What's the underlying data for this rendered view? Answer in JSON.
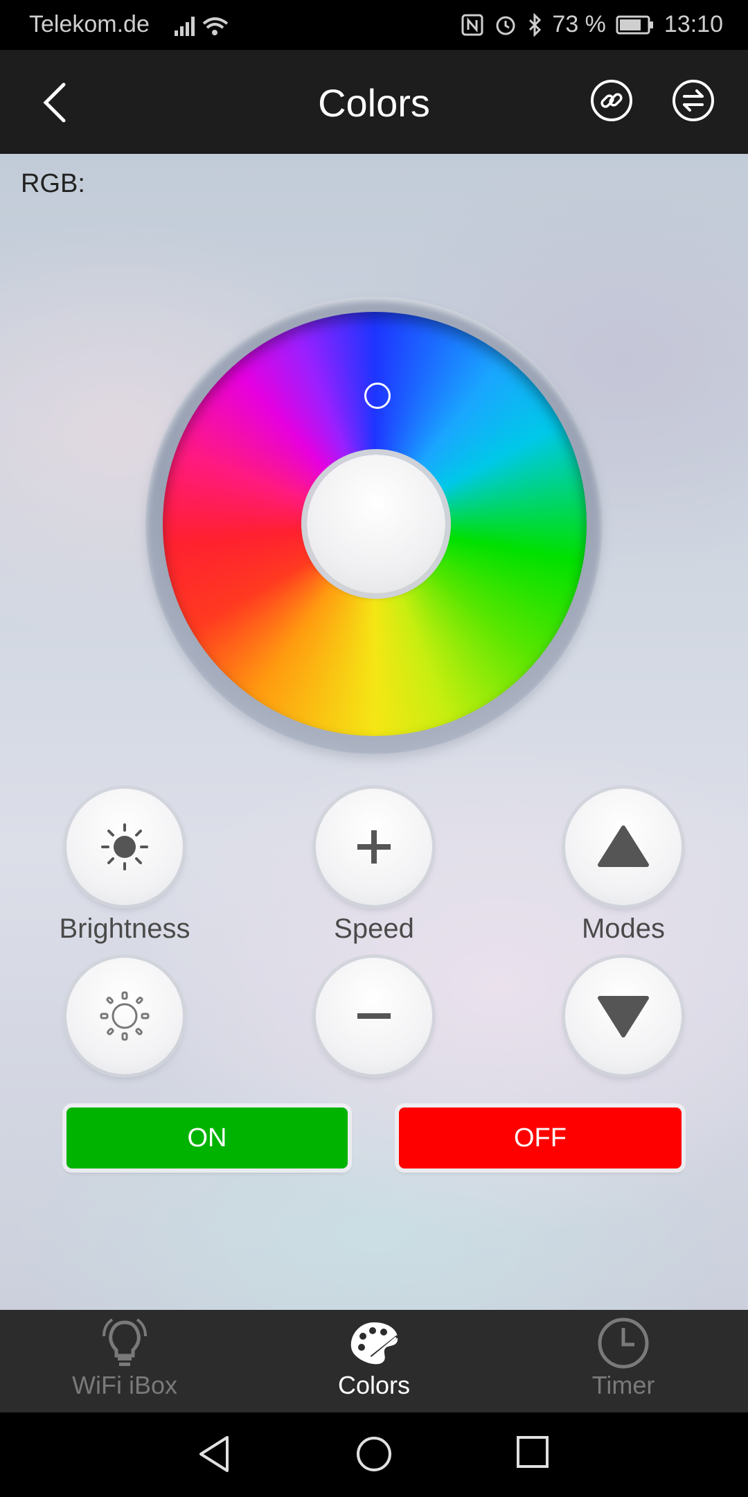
{
  "status_bar": {
    "carrier": "Telekom.de",
    "battery": "73 %",
    "time": "13:10",
    "icons": [
      "signal-icon",
      "wifi-icon",
      "nfc-icon",
      "alarm-icon",
      "bluetooth-icon",
      "battery-icon"
    ]
  },
  "header": {
    "title": "Colors",
    "back_icon": "back-arrow-icon",
    "link_icon": "link-icon",
    "swap_icon": "swap-icon"
  },
  "main": {
    "rgb_label": "RGB:"
  },
  "controls": {
    "brightness_label": "Brightness",
    "speed_label": "Speed",
    "modes_label": "Modes",
    "on_label": "ON",
    "off_label": "OFF"
  },
  "colors": {
    "on": "#00b300",
    "off": "#ff0000"
  },
  "bottom_nav": {
    "items": [
      {
        "label": "WiFi iBox",
        "icon": "bulb-icon",
        "active": false
      },
      {
        "label": "Colors",
        "icon": "palette-icon",
        "active": true
      },
      {
        "label": "Timer",
        "icon": "clock-icon",
        "active": false
      }
    ]
  },
  "system_nav": [
    "back-triangle-icon",
    "home-circle-icon",
    "recents-square-icon"
  ]
}
